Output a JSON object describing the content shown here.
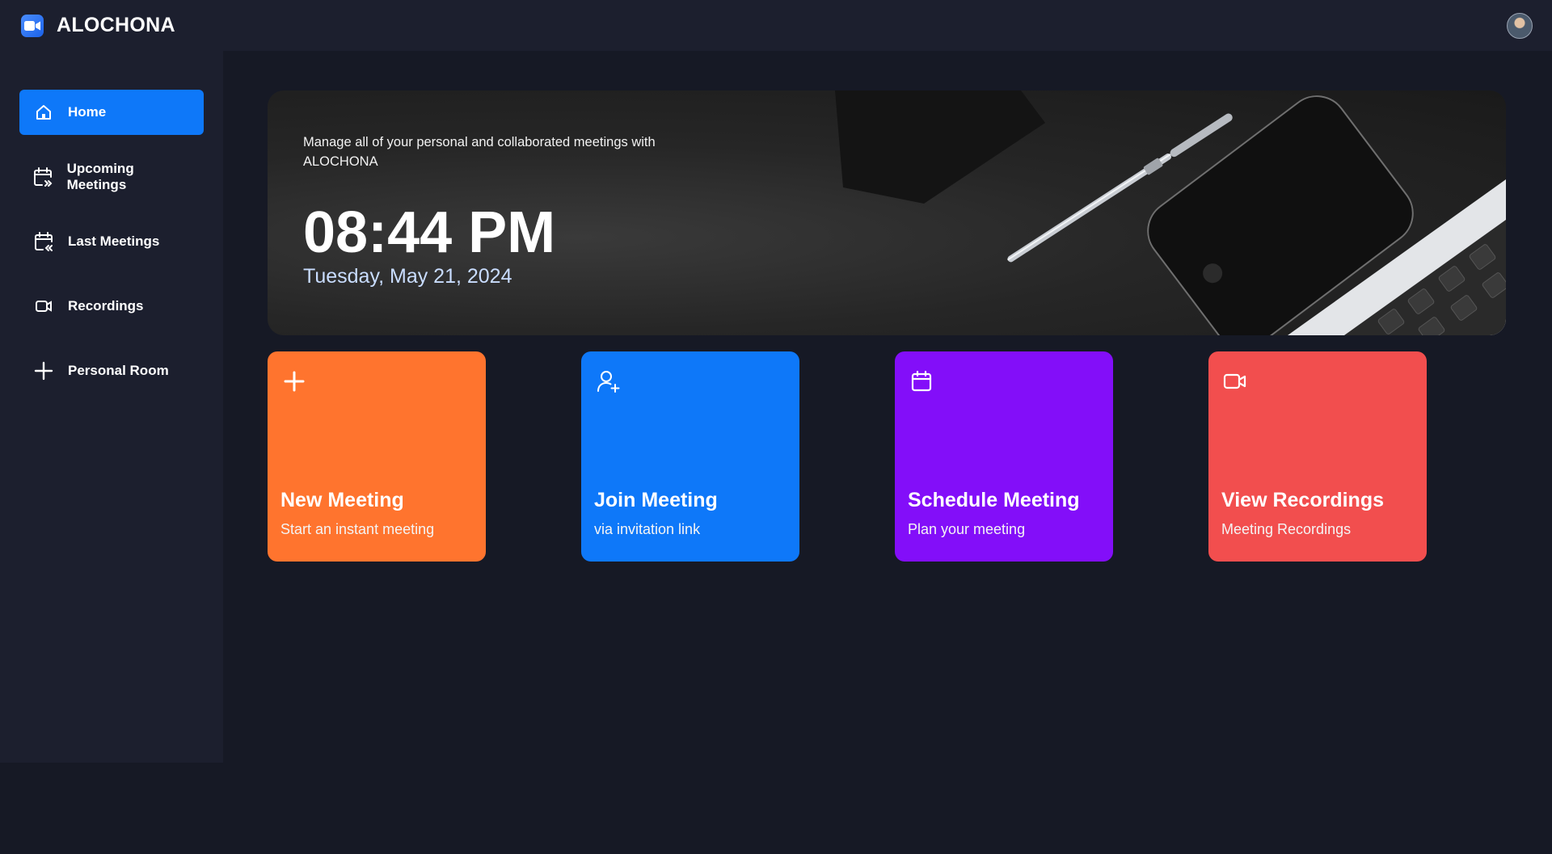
{
  "navbar": {
    "brand": "ALOCHONA",
    "logo_icon": "video-camera-icon",
    "avatar_icon": "user-avatar"
  },
  "sidebar": {
    "items": [
      {
        "label": "Home",
        "icon": "home-icon",
        "active": true
      },
      {
        "label": "Upcoming Meetings",
        "icon": "calendar-forward-icon",
        "active": false
      },
      {
        "label": "Last Meetings",
        "icon": "calendar-back-icon",
        "active": false
      },
      {
        "label": "Recordings",
        "icon": "recordings-icon",
        "active": false
      },
      {
        "label": "Personal Room",
        "icon": "plus-icon",
        "active": false
      }
    ]
  },
  "hero": {
    "subtitle": "Manage all of your personal and collaborated meetings with ALOCHONA",
    "time": "08:44 PM",
    "date": "Tuesday, May 21, 2024"
  },
  "cards": [
    {
      "title": "New Meeting",
      "subtitle": "Start an instant meeting",
      "icon": "plus-icon",
      "color": "#ff742e"
    },
    {
      "title": "Join Meeting",
      "subtitle": "via invitation link",
      "icon": "add-user-icon",
      "color": "#0e78f9"
    },
    {
      "title": "Schedule Meeting",
      "subtitle": "Plan your meeting",
      "icon": "calendar-icon",
      "color": "#830ef9"
    },
    {
      "title": "View Recordings",
      "subtitle": "Meeting Recordings",
      "icon": "video-icon",
      "color": "#f24e4e"
    }
  ],
  "colors": {
    "background": "#161925",
    "panel": "#1c1f2e",
    "accent": "#0e78f9"
  }
}
